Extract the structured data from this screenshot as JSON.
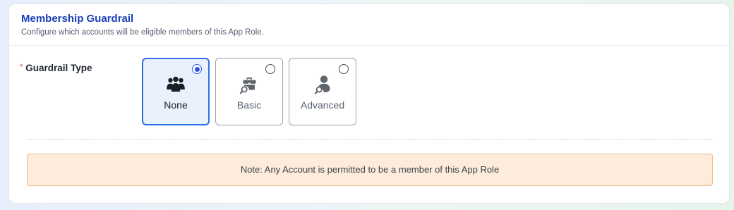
{
  "section": {
    "title": "Membership Guardrail",
    "subtitle": "Configure which accounts will be eligible members of this App Role."
  },
  "field": {
    "required_marker": "*",
    "label": "Guardrail Type"
  },
  "options": [
    {
      "label": "None",
      "icon": "group-icon",
      "selected": true
    },
    {
      "label": "Basic",
      "icon": "briefcase-search-icon",
      "selected": false
    },
    {
      "label": "Advanced",
      "icon": "person-search-icon",
      "selected": false
    }
  ],
  "note": {
    "text": "Note: Any Account is permitted to be a member of this App Role"
  },
  "colors": {
    "title": "#1a3fb8",
    "selected_border": "#2e6fe3",
    "selected_bg": "#e9f1fd",
    "note_bg": "#fdebdc",
    "note_border": "#f0b886",
    "required": "#d83a3a"
  }
}
